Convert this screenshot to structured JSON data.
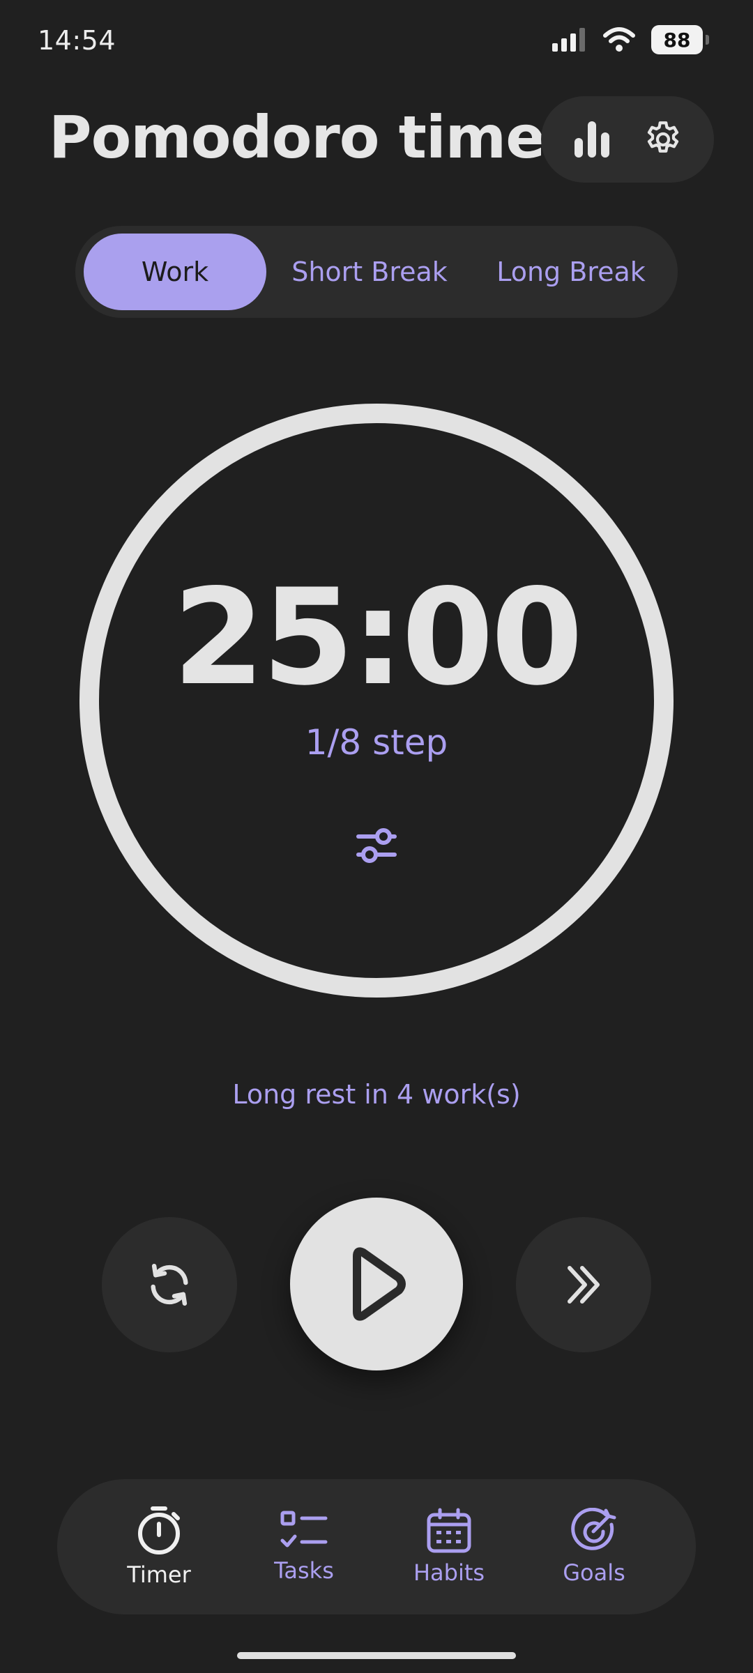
{
  "status_bar": {
    "time": "14:54",
    "battery": "88"
  },
  "header": {
    "title": "Pomodoro timer",
    "stats_icon": "bar-chart-icon",
    "settings_icon": "gear-icon"
  },
  "mode_tabs": [
    {
      "label": "Work",
      "active": true
    },
    {
      "label": "Short Break",
      "active": false
    },
    {
      "label": "Long Break",
      "active": false
    }
  ],
  "timer": {
    "value": "25:00",
    "step": "1/8 step",
    "progress": 0,
    "adjust_icon": "sliders-icon"
  },
  "long_rest": "Long rest in 4 work(s)",
  "controls": {
    "reset_icon": "refresh-icon",
    "play_icon": "play-icon",
    "skip_icon": "double-chevron-right-icon"
  },
  "nav": [
    {
      "label": "Timer",
      "icon": "stopwatch-icon",
      "active": true
    },
    {
      "label": "Tasks",
      "icon": "checklist-icon",
      "active": false
    },
    {
      "label": "Habits",
      "icon": "calendar-icon",
      "active": false
    },
    {
      "label": "Goals",
      "icon": "target-icon",
      "active": false
    }
  ],
  "colors": {
    "background": "#202020",
    "surface": "#2c2c2c",
    "accent": "#aaa0ee",
    "foreground": "#e2e2e2"
  }
}
